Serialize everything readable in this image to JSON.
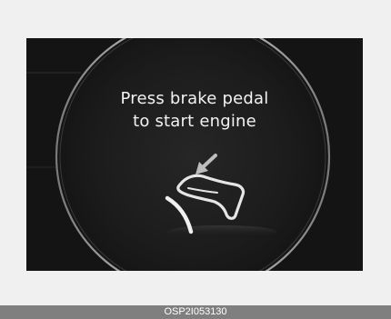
{
  "display": {
    "message_line1": "Press brake pedal",
    "message_line2": "to start engine",
    "icon": "brake-pedal-press-icon"
  },
  "caption": {
    "code": "OSP2I053130"
  },
  "colors": {
    "page_background": "#f0f0f0",
    "screen_background": "#141414",
    "text": "#f3f3f3",
    "caption_bar": "#7f7f7f",
    "caption_text": "#ffffff"
  }
}
